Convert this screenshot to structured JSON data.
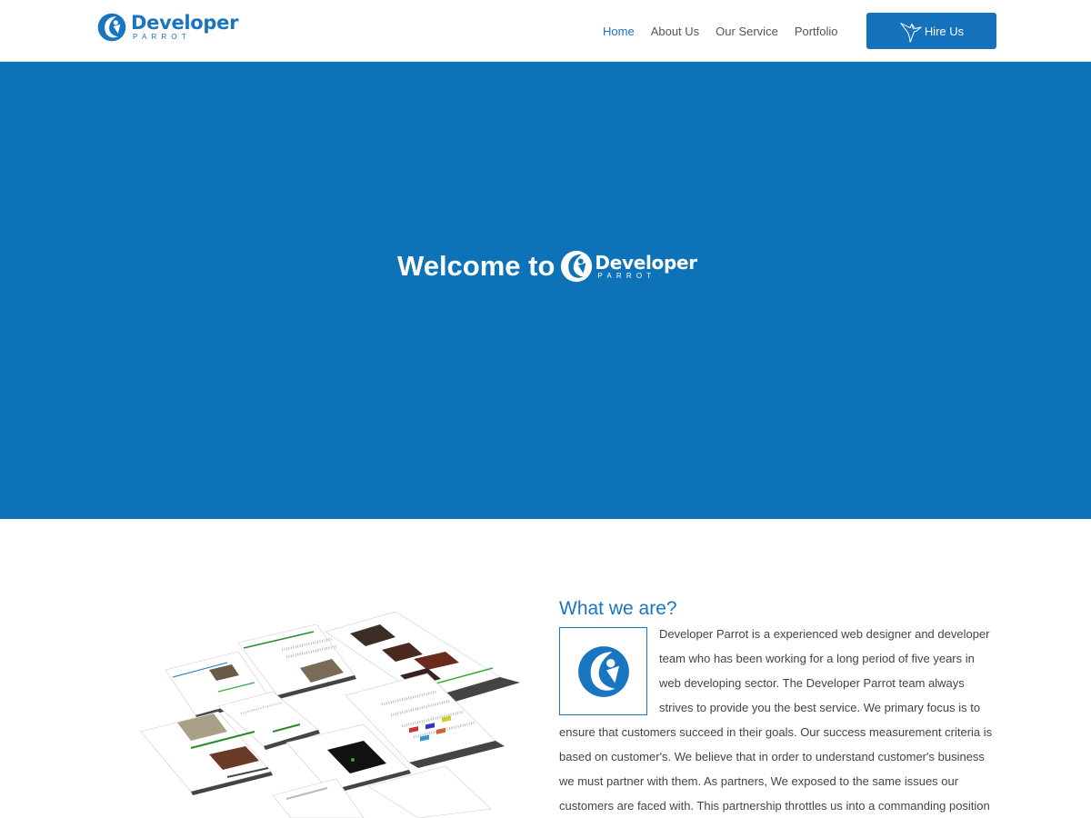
{
  "brand": {
    "name": "Developer",
    "sub": "PARROT",
    "accent": "#1a75c0",
    "hero_bg": "#0e72b9"
  },
  "nav": {
    "items": [
      {
        "label": "Home",
        "active": true
      },
      {
        "label": "About Us",
        "active": false
      },
      {
        "label": "Our Service",
        "active": false
      },
      {
        "label": "Portfolio",
        "active": false
      }
    ],
    "hire_label": "Hire Us",
    "hire_icon": "hummingbird-icon"
  },
  "hero": {
    "title": "Welcome to",
    "logo_word": "Developer",
    "logo_sub": "PARROT"
  },
  "about": {
    "title": "What we are?",
    "body": "Developer Parrot is a experienced web designer and developer team who has been working for a long period of five years in web developing sector. The Developer Parrot team always strives to provide you the best service. We primary focus is to ensure that customers succeed in their goals. Our success measurement criteria is based on customer's. We believe that in order to understand customer's business we must partner with them. As partners, We exposed to the same issues our customers are faced with. This partnership throttles us into a commanding position to lay out a plan"
  }
}
